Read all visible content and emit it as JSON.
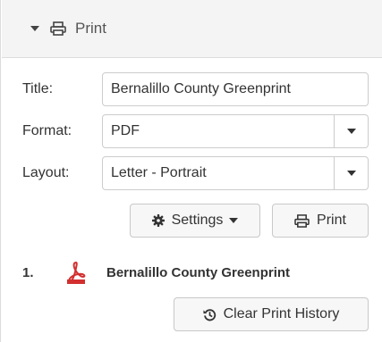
{
  "panel": {
    "header_title": "Print"
  },
  "form": {
    "title_label": "Title:",
    "title_value": "Bernalillo County Greenprint",
    "format_label": "Format:",
    "format_value": "PDF",
    "layout_label": "Layout:",
    "layout_value": "Letter - Portrait"
  },
  "buttons": {
    "settings_label": "Settings",
    "print_label": "Print",
    "clear_history_label": "Clear Print History"
  },
  "history": {
    "items": [
      {
        "index": "1.",
        "title": "Bernalillo County Greenprint",
        "icon": "pdf-file-icon"
      }
    ]
  },
  "colors": {
    "header_bg": "#f4f4f4",
    "button_bg": "#f7f7f7",
    "pdf_red": "#d32f2f"
  }
}
